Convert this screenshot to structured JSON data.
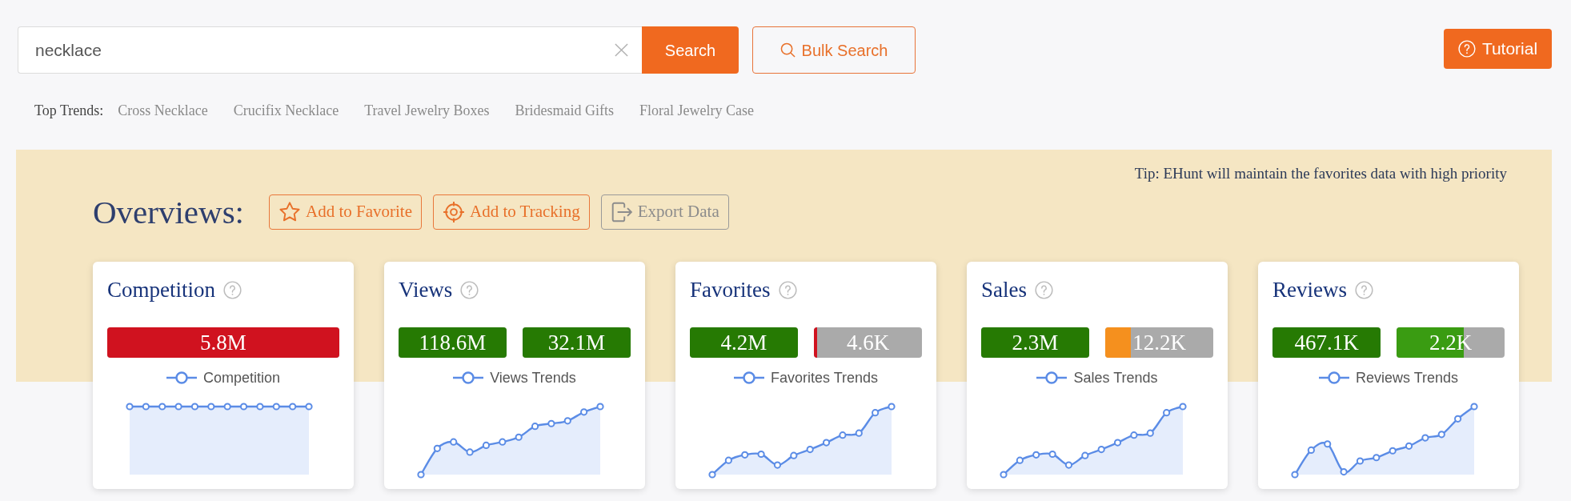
{
  "search": {
    "value": "necklace",
    "button": "Search"
  },
  "bulk_search": {
    "label": "Bulk Search"
  },
  "tutorial": {
    "label": "Tutorial"
  },
  "top_trends": {
    "label": "Top Trends:",
    "items": [
      "Cross Necklace",
      "Crucifix Necklace",
      "Travel Jewelry Boxes",
      "Bridesmaid Gifts",
      "Floral Jewelry Case"
    ]
  },
  "overview": {
    "tip": "Tip: EHunt will maintain the favorites data with high priority",
    "title": "Overviews:",
    "actions": [
      {
        "kind": "favorite",
        "label": "Add to Favorite",
        "disabled": false
      },
      {
        "kind": "tracking",
        "label": "Add to Tracking",
        "disabled": false
      },
      {
        "kind": "export",
        "label": "Export Data",
        "disabled": true
      }
    ]
  },
  "cards": [
    {
      "title": "Competition",
      "bars": [
        {
          "value": "5.8M",
          "color": "#d0121f",
          "level": 1
        }
      ],
      "legend": "Competition"
    },
    {
      "title": "Views",
      "bars": [
        {
          "value": "118.6M",
          "color": "#267a03",
          "level": 1
        },
        {
          "value": "32.1M",
          "color": "#267a03",
          "level": 1
        }
      ],
      "legend": "Views Trends"
    },
    {
      "title": "Favorites",
      "bars": [
        {
          "value": "4.2M",
          "color": "#267a03",
          "level": 1
        },
        {
          "value": "4.6K",
          "color": "#d0121f",
          "level": 0.03
        }
      ],
      "legend": "Favorites Trends"
    },
    {
      "title": "Sales",
      "bars": [
        {
          "value": "2.3M",
          "color": "#267a03",
          "level": 1
        },
        {
          "value": "12.2K",
          "color": "#f5901e",
          "level": 0.24
        }
      ],
      "legend": "Sales Trends"
    },
    {
      "title": "Reviews",
      "bars": [
        {
          "value": "467.1K",
          "color": "#267a03",
          "level": 1
        },
        {
          "value": "2.2K",
          "color": "#3a9c12",
          "level": 0.62
        }
      ],
      "legend": "Reviews Trends"
    }
  ]
}
